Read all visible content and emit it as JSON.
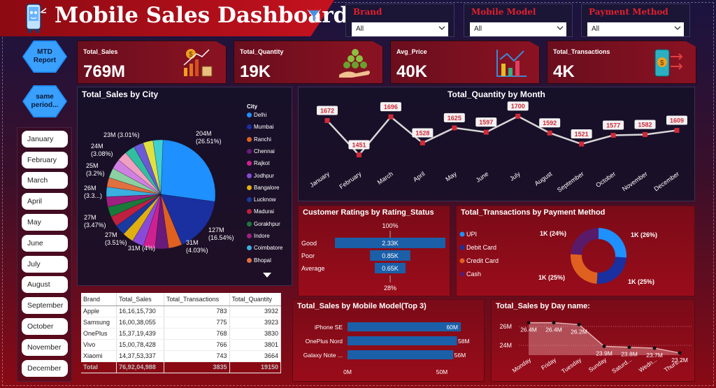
{
  "header": {
    "title": "Mobile Sales Dashboard"
  },
  "filters": [
    {
      "label": "Brand",
      "value": "All"
    },
    {
      "label": "Mobile Model",
      "value": "All"
    },
    {
      "label": "Payment Method",
      "value": "All"
    }
  ],
  "side_buttons": {
    "mtd": "MTD\nReport",
    "same_period": "same\nperiod..."
  },
  "months": [
    "January",
    "February",
    "March",
    "April",
    "May",
    "June",
    "July",
    "August",
    "September",
    "October",
    "November",
    "December"
  ],
  "kpis": [
    {
      "label": "Total_Sales",
      "value": "769M",
      "icon": "money-growth-icon"
    },
    {
      "label": "Total_Quantity",
      "value": "19K",
      "icon": "coin-stack-hand-icon"
    },
    {
      "label": "Avg_Price",
      "value": "40K",
      "icon": "bar-chart-arrow-icon"
    },
    {
      "label": "Total_Transactions",
      "value": "4K",
      "icon": "phone-payment-icon"
    }
  ],
  "colors": {
    "accent_red": "#e0202a",
    "bar_blue": "#1b5fa8",
    "panel_dark": "#141028"
  },
  "sales_by_city": {
    "title": "Total_Sales by City",
    "legend_title": "City",
    "cities": [
      {
        "name": "Delhi",
        "color": "#1e90ff"
      },
      {
        "name": "Mumbai",
        "color": "#1a2fa0"
      },
      {
        "name": "Ranchi",
        "color": "#e06020"
      },
      {
        "name": "Chennai",
        "color": "#6a1a7a"
      },
      {
        "name": "Rajkot",
        "color": "#d02090"
      },
      {
        "name": "Jodhpur",
        "color": "#8a4ad8"
      },
      {
        "name": "Bangalore",
        "color": "#e0b010"
      },
      {
        "name": "Lucknow",
        "color": "#1a3aa0"
      },
      {
        "name": "Madurai",
        "color": "#c02040"
      },
      {
        "name": "Gorakhpur",
        "color": "#1a7a3a"
      },
      {
        "name": "Indore",
        "color": "#a02080"
      },
      {
        "name": "Coimbatore",
        "color": "#3ab0e0"
      },
      {
        "name": "Bhopal",
        "color": "#e07040"
      }
    ],
    "labels": [
      {
        "text": "204M\n(26.51%)"
      },
      {
        "text": "127M\n(16.54%)"
      },
      {
        "text": "31M\n(4.03%)"
      },
      {
        "text": "31M (4%)"
      },
      {
        "text": "27M\n(3.51%)"
      },
      {
        "text": "27M\n(3.47%)"
      },
      {
        "text": "26M\n(3.3...)"
      },
      {
        "text": "25M\n(3.2%)"
      },
      {
        "text": "24M\n(3.08%)"
      },
      {
        "text": "23M (3.01%)"
      }
    ]
  },
  "brand_table": {
    "headers": [
      "Brand",
      "Total_Sales",
      "Total_Transactions",
      "Total_Quantity"
    ],
    "rows": [
      [
        "Apple",
        "16,16,15,730",
        "783",
        "3932"
      ],
      [
        "Samsung",
        "16,00,38,055",
        "775",
        "3923"
      ],
      [
        "OnePlus",
        "15,37,19,439",
        "768",
        "3830"
      ],
      [
        "Vivo",
        "15,00,78,428",
        "766",
        "3801"
      ],
      [
        "Xiaomi",
        "14,37,53,337",
        "743",
        "3664"
      ]
    ],
    "total": [
      "Total",
      "76,92,04,988",
      "3835",
      "19150"
    ]
  },
  "chart_data": [
    {
      "type": "line",
      "title": "Total_Quantity by Month",
      "categories": [
        "January",
        "February",
        "March",
        "April",
        "May",
        "June",
        "July",
        "August",
        "September",
        "October",
        "November",
        "December"
      ],
      "values": [
        1672,
        1451,
        1696,
        1528,
        1625,
        1597,
        1700,
        1592,
        1521,
        1577,
        1582,
        1609
      ]
    },
    {
      "type": "bar",
      "title": "Customer Ratings by Rating_Status",
      "categories": [
        "Good",
        "Poor",
        "Average"
      ],
      "values": [
        2330,
        850,
        650
      ],
      "value_labels": [
        "2.33K",
        "0.85K",
        "0.65K"
      ],
      "top_label": "100%",
      "bottom_label": "28%"
    },
    {
      "type": "pie",
      "title": "Total_Transactions by Payment Method",
      "categories": [
        "UPI",
        "Debit Card",
        "Credit Card",
        "Cash"
      ],
      "values": [
        26,
        25,
        25,
        24
      ],
      "value_labels": [
        "1K (26%)",
        "1K (25%)",
        "1K (25%)",
        "1K (24%)"
      ],
      "colors": [
        "#1e90ff",
        "#1a2fa0",
        "#e06020",
        "#5a1a6a"
      ]
    },
    {
      "type": "bar",
      "title": "Total_Sales by Mobile Model(Top 3)",
      "categories": [
        "iPhone SE",
        "OnePlus Nord",
        "Galaxy Note ..."
      ],
      "values": [
        60,
        58,
        56
      ],
      "value_labels": [
        "60M",
        "58M",
        "56M"
      ],
      "x_ticks": [
        "0M",
        "50M"
      ]
    },
    {
      "type": "area",
      "title": "Total_Sales by Day name:",
      "categories": [
        "Monday",
        "Friday",
        "Tuesday",
        "Sunday",
        "Saturd...",
        "Wedn...",
        "Thurs..."
      ],
      "values": [
        26.4,
        26.4,
        26.2,
        23.9,
        23.8,
        23.7,
        23.2
      ],
      "value_labels": [
        "26.4M",
        "26.4M",
        "26.2M",
        "23.9M",
        "23.8M",
        "23.7M",
        "23.2M"
      ],
      "y_ticks": [
        "26M",
        "24M"
      ]
    }
  ]
}
